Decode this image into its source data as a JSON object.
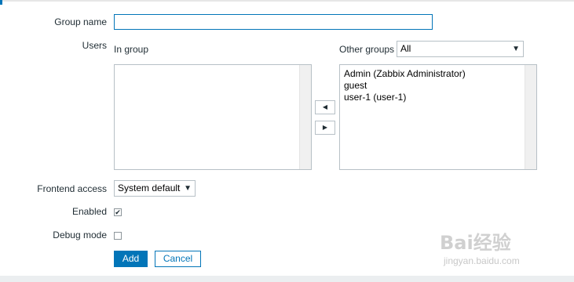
{
  "form": {
    "group_name": {
      "label": "Group name",
      "value": ""
    },
    "users": {
      "label": "Users",
      "in_group": {
        "label": "In group",
        "items": []
      },
      "other_groups": {
        "label": "Other groups",
        "filter_value": "All",
        "items": [
          "Admin (Zabbix Administrator)",
          "guest",
          "user-1 (user-1)"
        ]
      },
      "move_left_icon": "triangle-left-icon",
      "move_right_icon": "triangle-right-icon"
    },
    "frontend_access": {
      "label": "Frontend access",
      "value": "System default"
    },
    "enabled": {
      "label": "Enabled",
      "checked": true
    },
    "debug_mode": {
      "label": "Debug mode",
      "checked": false
    },
    "buttons": {
      "add": "Add",
      "cancel": "Cancel"
    }
  },
  "watermark": {
    "logo": "Bai经验",
    "url": "jingyan.baidu.com"
  },
  "colors": {
    "accent": "#0275b8",
    "border": "#b7c0c6",
    "text": "#1f2c33"
  }
}
